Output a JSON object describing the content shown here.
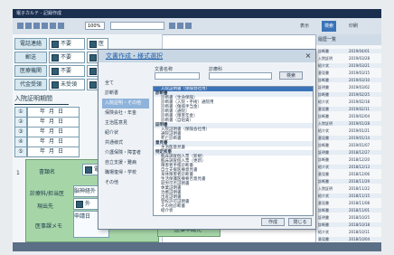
{
  "window": {
    "title": "電子カルテ - 記録作成"
  },
  "toolbar": {
    "zoom": "100%",
    "search_value": "",
    "right_tabs": [
      "表示",
      "検索",
      "印刷"
    ]
  },
  "form": {
    "rows": [
      {
        "label": "電話連絡",
        "value": "不要",
        "extra": "医"
      },
      {
        "label": "郵送",
        "value": "不要",
        "extra": "医"
      },
      {
        "label": "医療機関",
        "value": "不要",
        "extra": "医"
      },
      {
        "label": "代金受領",
        "value": "未受領",
        "extra": "医"
      }
    ],
    "section_title": "入院証明期間",
    "dates": [
      {
        "num": "①",
        "text": "年月日"
      },
      {
        "num": "②",
        "text": "年月日"
      },
      {
        "num": "③",
        "text": "年月日"
      },
      {
        "num": "④",
        "text": "年月日"
      },
      {
        "num": "⑤",
        "text": "年月日"
      }
    ],
    "doc_name_label": "書類名",
    "doc_name_value": "電",
    "dept_label": "診療科/担当医",
    "dept_value": "脳神経外",
    "status_label": "現出先",
    "status_value": "外",
    "memo_label": "医事課メモ",
    "memo_value": "申請日",
    "bottom_label": "医事申請先",
    "index_labels": [
      "1",
      "2"
    ]
  },
  "dialog": {
    "title": "文書作成・様式選択",
    "close": "×",
    "field_labels": [
      "文書名称",
      "診療科"
    ],
    "search_button": "検索",
    "categories": [
      "全て",
      "診断書",
      "入院証明・その他",
      "保険会社・年金",
      "主治医意見",
      "紹介状",
      "共通様式",
      "介護保険・障害者",
      "自立支援・難病",
      "職場復帰・学校",
      "その他"
    ],
    "active_category": 2,
    "items": [
      {
        "text": "入院証明書（保険会社用）",
        "group": false,
        "selected": true
      },
      {
        "text": "診断書",
        "group": true,
        "selected": false
      },
      {
        "text": "診断書（生命保険）",
        "group": false,
        "selected": false
      },
      {
        "text": "診断書（入院・手術）通院用",
        "group": false,
        "selected": false
      },
      {
        "text": "診断書（傷病手当金）",
        "group": false,
        "selected": false
      },
      {
        "text": "診断書（通院）",
        "group": false,
        "selected": false
      },
      {
        "text": "診断書（障害年金）",
        "group": false,
        "selected": false
      },
      {
        "text": "診断書（自賠責）",
        "group": false,
        "selected": false
      },
      {
        "text": "証明書",
        "group": true,
        "selected": false
      },
      {
        "text": "入院証明書（保険会社用）",
        "group": false,
        "selected": false
      },
      {
        "text": "通院証明書",
        "group": false,
        "selected": false
      },
      {
        "text": "死亡診断書",
        "group": false,
        "selected": false
      },
      {
        "text": "意見書",
        "group": true,
        "selected": false
      },
      {
        "text": "主治医意見書",
        "group": false,
        "selected": false
      },
      {
        "text": "特定疾患",
        "group": true,
        "selected": false
      },
      {
        "text": "臨床調査個人票（新規）",
        "group": false,
        "selected": false
      },
      {
        "text": "臨床調査個人票（更新）",
        "group": false,
        "selected": false
      },
      {
        "text": "障害者手帳診断書",
        "group": false,
        "selected": false
      },
      {
        "text": "自立支援医療意見書",
        "group": false,
        "selected": false
      },
      {
        "text": "身体障害者診断書",
        "group": false,
        "selected": false
      },
      {
        "text": "生活保護医療要否意見書",
        "group": false,
        "selected": false
      },
      {
        "text": "就労可否証明書",
        "group": false,
        "selected": false
      },
      {
        "text": "休業証明書",
        "group": false,
        "selected": false
      },
      {
        "text": "治癒証明書",
        "group": false,
        "selected": false
      },
      {
        "text": "出産証明書",
        "group": false,
        "selected": false
      },
      {
        "text": "登校許可証明書",
        "group": false,
        "selected": false
      },
      {
        "text": "その他診断書",
        "group": false,
        "selected": false
      },
      {
        "text": "紹介状",
        "group": false,
        "selected": false
      }
    ],
    "ok_button": "作成",
    "cancel_button": "閉じる"
  },
  "right_panel": {
    "header": "履歴一覧",
    "rows": [
      [
        "診断書",
        "2019/04/01"
      ],
      [
        "入院証明",
        "2019/03/28"
      ],
      [
        "紹介状",
        "2019/03/21"
      ],
      [
        "意見書",
        "2019/03/15"
      ],
      [
        "診断書",
        "2019/03/10"
      ],
      [
        "証明書",
        "2019/03/02"
      ],
      [
        "診断書",
        "2019/02/25"
      ],
      [
        "紹介状",
        "2019/02/18"
      ],
      [
        "意見書",
        "2019/02/11"
      ],
      [
        "診断書",
        "2019/02/04"
      ],
      [
        "入院証明",
        "2019/01/28"
      ],
      [
        "紹介状",
        "2019/01/21"
      ],
      [
        "意見書",
        "2019/01/14"
      ],
      [
        "診断書",
        "2019/01/07"
      ],
      [
        "証明書",
        "2018/12/27"
      ],
      [
        "診断書",
        "2018/12/20"
      ],
      [
        "紹介状",
        "2018/12/13"
      ],
      [
        "意見書",
        "2018/12/06"
      ],
      [
        "診断書",
        "2018/11/29"
      ],
      [
        "入院証明",
        "2018/11/22"
      ],
      [
        "紹介状",
        "2018/11/15"
      ],
      [
        "意見書",
        "2018/11/08"
      ],
      [
        "診断書",
        "2018/11/01"
      ],
      [
        "証明書",
        "2018/10/25"
      ],
      [
        "診断書",
        "2018/10/18"
      ],
      [
        "紹介状",
        "2018/10/11"
      ],
      [
        "意見書",
        "2018/10/04"
      ]
    ]
  },
  "colors": {
    "accent": "#3b73b9",
    "form_green": "#a6d6a8",
    "titlebar": "#1b2f4f"
  }
}
